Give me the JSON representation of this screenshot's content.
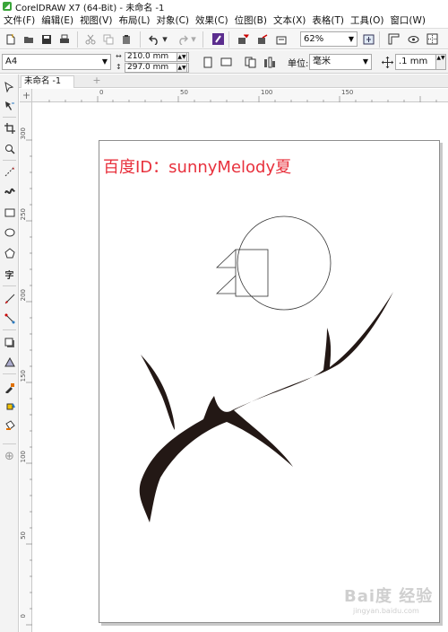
{
  "window": {
    "title": "CorelDRAW X7 (64-Bit) - 未命名 -1"
  },
  "menu": {
    "items": [
      {
        "label": "文件(F)"
      },
      {
        "label": "编辑(E)"
      },
      {
        "label": "视图(V)"
      },
      {
        "label": "布局(L)"
      },
      {
        "label": "对象(C)"
      },
      {
        "label": "效果(C)"
      },
      {
        "label": "位图(B)"
      },
      {
        "label": "文本(X)"
      },
      {
        "label": "表格(T)"
      },
      {
        "label": "工具(O)"
      },
      {
        "label": "窗口(W)"
      }
    ]
  },
  "toolbar": {
    "zoom_value": "62%"
  },
  "property_bar": {
    "page_size": "A4",
    "width": "210.0 mm",
    "height": "297.0 mm",
    "units_label": "单位:",
    "units_value": "毫米",
    "nudge_value": ".1 mm"
  },
  "document": {
    "tab_label": "未命名 -1",
    "add_tab": "+"
  },
  "rulers": {
    "horizontal_ticks": [
      "0",
      "50",
      "100",
      "150"
    ],
    "vertical_ticks": [
      "300",
      "250",
      "200",
      "150",
      "100",
      "50",
      "0"
    ]
  },
  "page": {
    "text": "百度ID：sunnyMelody夏"
  },
  "watermark": {
    "logo": "Bai度 经验",
    "url": "jingyan.baidu.com"
  },
  "colors": {
    "text_red": "#e8313d",
    "branch_fill": "#231815"
  }
}
